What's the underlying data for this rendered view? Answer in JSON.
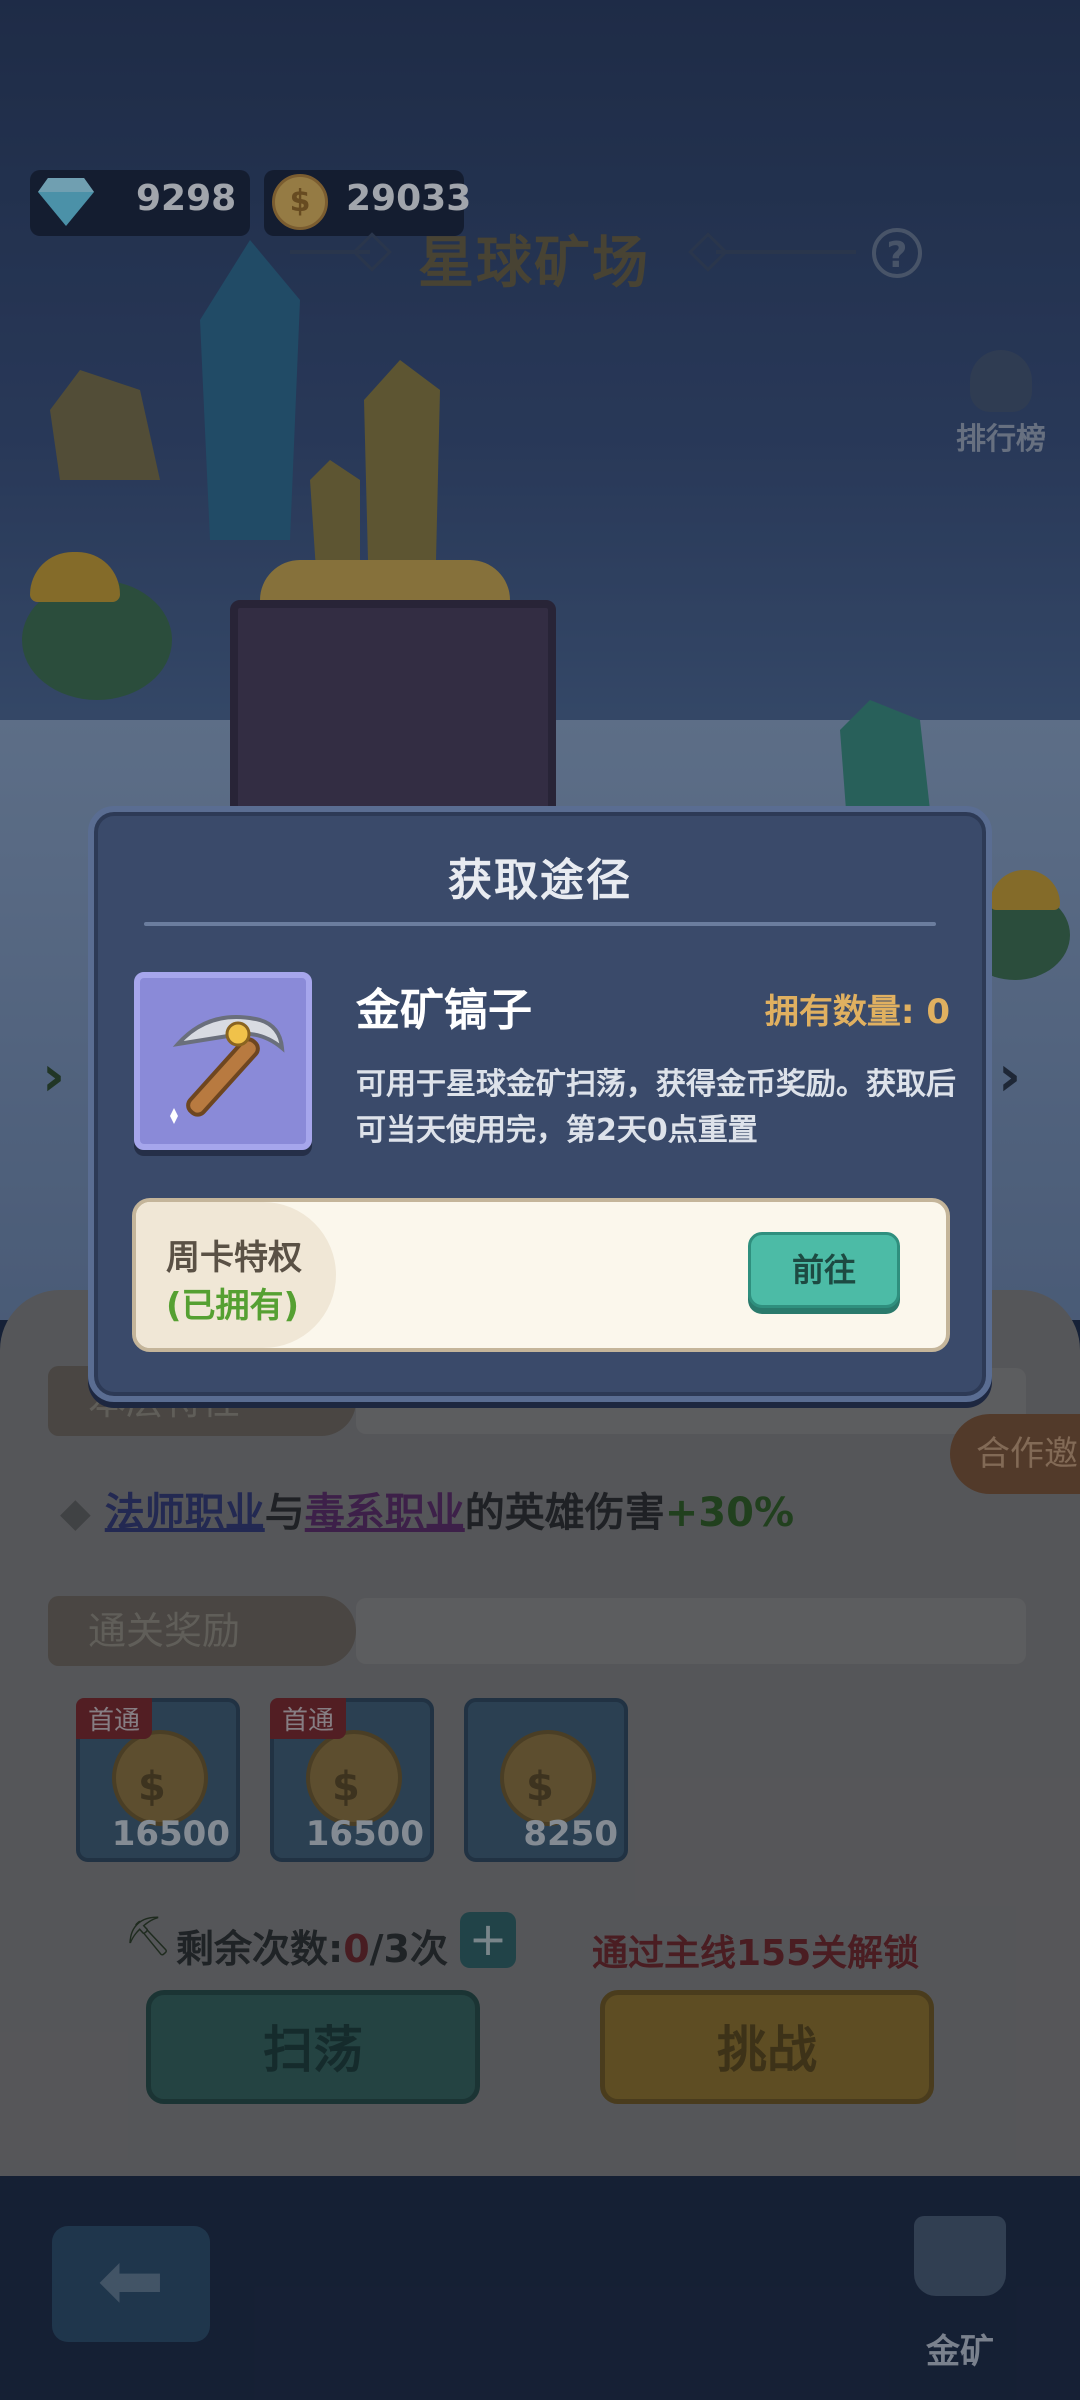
{
  "hud": {
    "gems": "9298",
    "coins": "29033"
  },
  "header": {
    "title": "星球矿场",
    "help": "?",
    "rank_label": "排行榜"
  },
  "dialog": {
    "title": "获取途径",
    "item_name": "金矿镐子",
    "owned_label": "拥有数量: 0",
    "description_line1": "可用于星球金矿扫荡，获得金币奖励。获取后",
    "description_line2": "可当天使用完，第2天0点重置",
    "source": {
      "name": "周卡特权",
      "status": "(已拥有)",
      "goto_label": "前往"
    }
  },
  "panel": {
    "traits_tag": "本层特性",
    "bonus": {
      "bullet": "◆",
      "mage": "法师职业",
      "with": "与",
      "poison": "毒系职业",
      "rest": "的英雄伤害",
      "plus": "+30%"
    },
    "rewards_tag": "通关奖励",
    "rewards": [
      {
        "first": "首通",
        "amount": "16500"
      },
      {
        "first": "首通",
        "amount": "16500"
      },
      {
        "first": "",
        "amount": "8250"
      }
    ],
    "remaining_label": "剩余次数:",
    "remaining_used": "0",
    "remaining_total": "/3次",
    "unlock_text": "通过主线155关解锁",
    "sweep_label": "扫荡",
    "challenge_label": "挑战",
    "coop_label": "合作邀"
  },
  "bottom": {
    "back_icon": "arrow-left-icon",
    "mine_label": "金矿"
  },
  "colors": {
    "dialog_bg": "#3a4a6a",
    "goto_button": "#4cbba6",
    "owned_text": "#e0b060",
    "owned_status": "#55a032"
  }
}
